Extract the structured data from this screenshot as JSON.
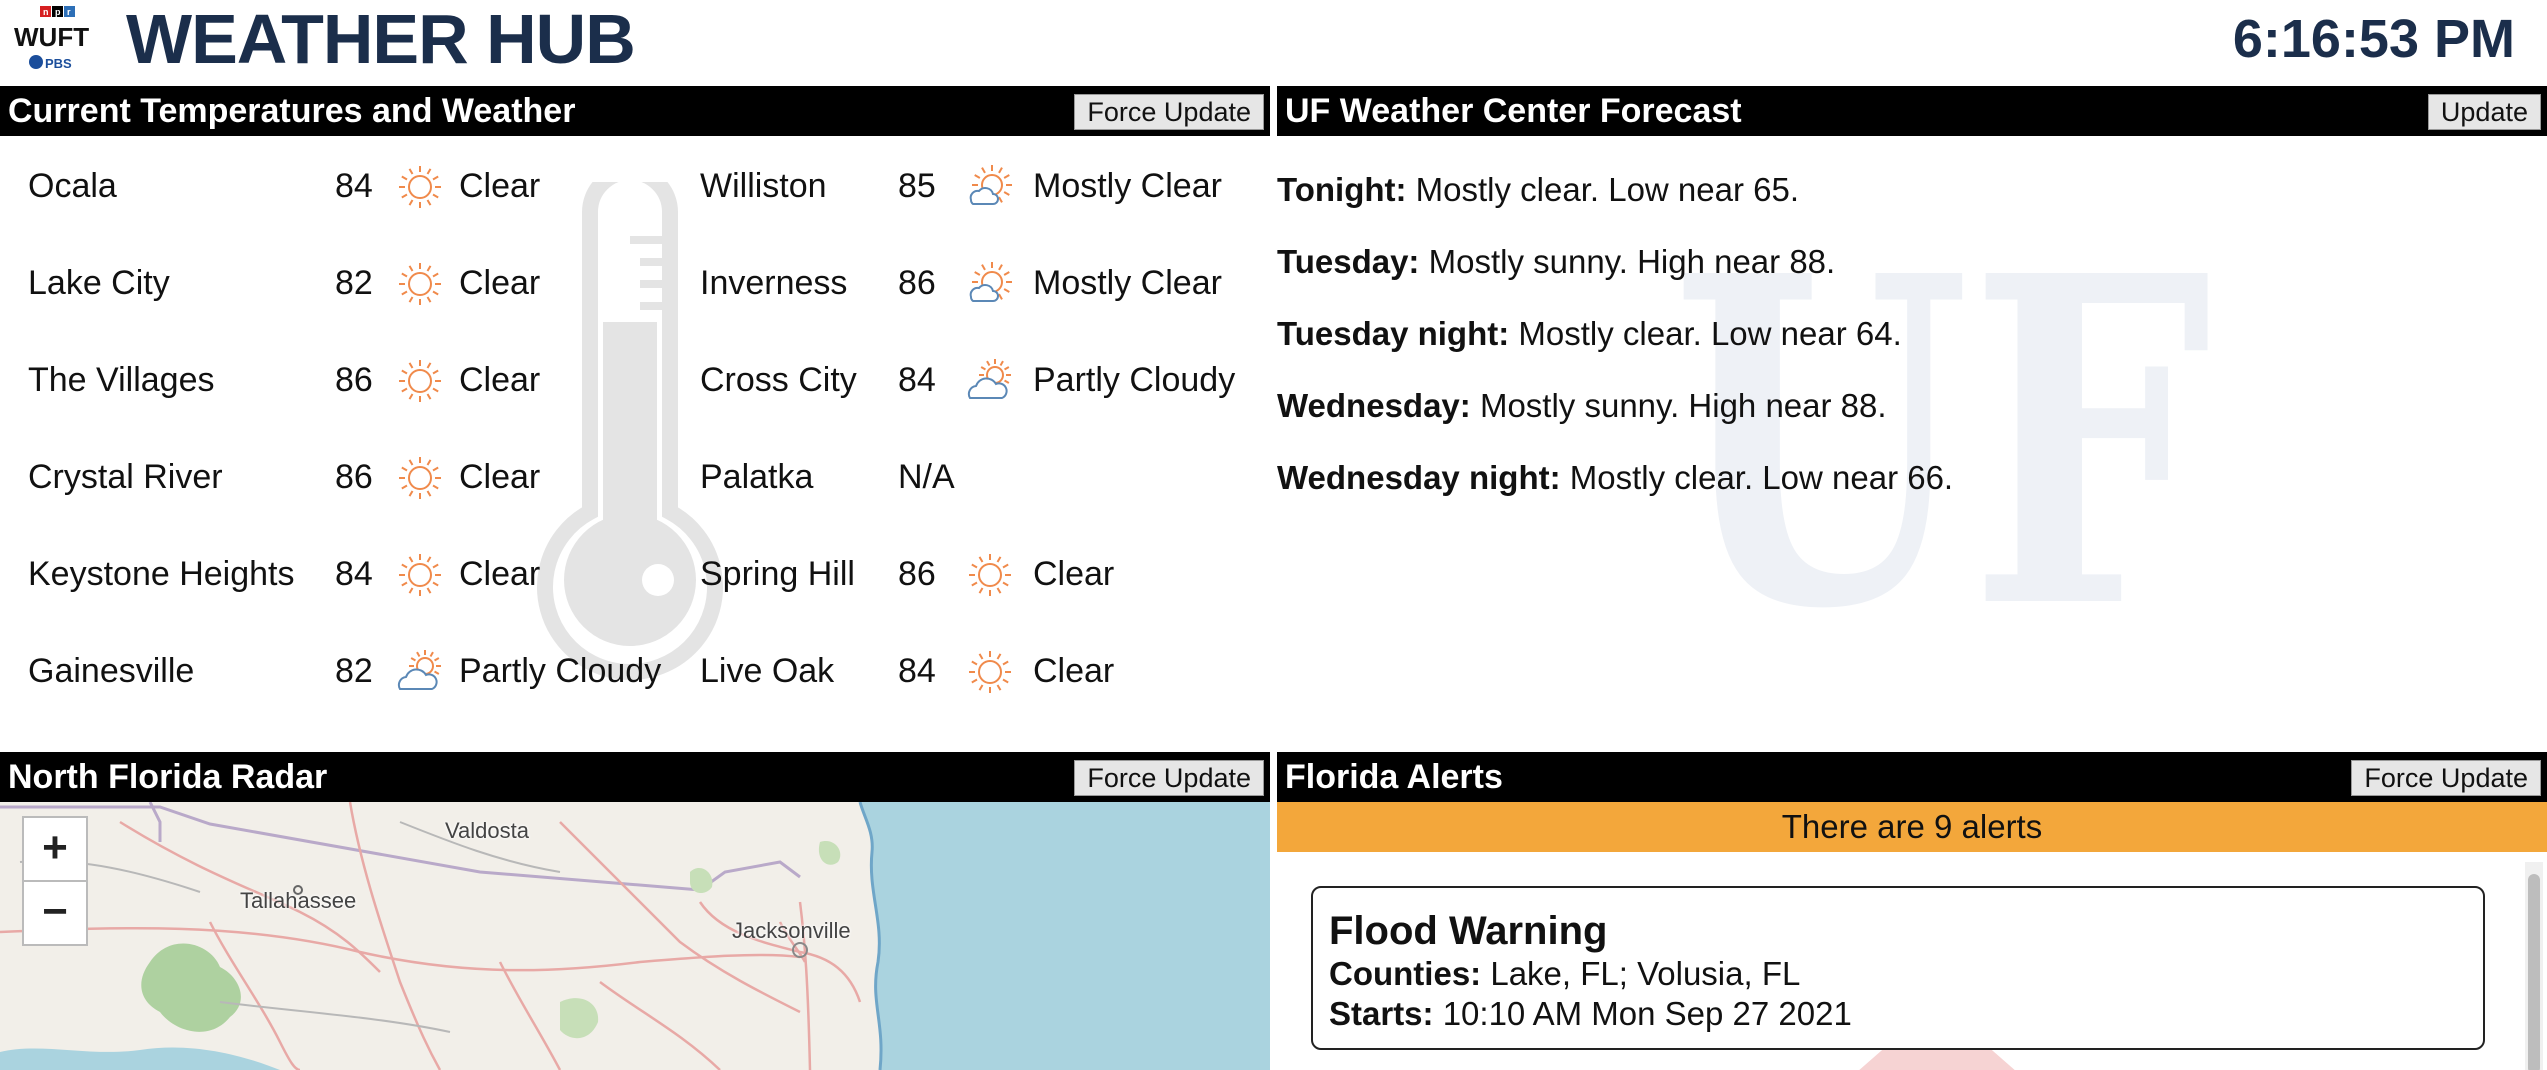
{
  "header": {
    "logo_top": "npr",
    "logo_mid": "WUFT",
    "logo_bottom": "PBS",
    "title": "WEATHER HUB",
    "clock": "6:16:53 PM"
  },
  "temps_panel": {
    "title": "Current Temperatures and Weather",
    "button": "Force Update",
    "left_column": [
      {
        "city": "Ocala",
        "temp": "84",
        "icon": "sun-icon",
        "condition": "Clear"
      },
      {
        "city": "Lake City",
        "temp": "82",
        "icon": "sun-icon",
        "condition": "Clear"
      },
      {
        "city": "The Villages",
        "temp": "86",
        "icon": "sun-icon",
        "condition": "Clear"
      },
      {
        "city": "Crystal River",
        "temp": "86",
        "icon": "sun-icon",
        "condition": "Clear"
      },
      {
        "city": "Keystone Heights",
        "temp": "84",
        "icon": "sun-icon",
        "condition": "Clear"
      },
      {
        "city": "Gainesville",
        "temp": "82",
        "icon": "partly-cloudy-icon",
        "condition": "Partly Cloudy"
      }
    ],
    "right_column": [
      {
        "city": "Williston",
        "temp": "85",
        "icon": "mostly-clear-icon",
        "condition": "Mostly Clear"
      },
      {
        "city": "Inverness",
        "temp": "86",
        "icon": "mostly-clear-icon",
        "condition": "Mostly Clear"
      },
      {
        "city": "Cross City",
        "temp": "84",
        "icon": "partly-cloudy-icon",
        "condition": "Partly Cloudy"
      },
      {
        "city": "Palatka",
        "temp": "N/A",
        "icon": "",
        "condition": ""
      },
      {
        "city": "Spring Hill",
        "temp": "86",
        "icon": "sun-icon",
        "condition": "Clear"
      },
      {
        "city": "Live Oak",
        "temp": "84",
        "icon": "sun-icon",
        "condition": "Clear"
      }
    ]
  },
  "forecast_panel": {
    "title": "UF Weather Center Forecast",
    "button": "Update",
    "watermark": "UF",
    "periods": [
      {
        "label": "Tonight:",
        "text": " Mostly clear. Low near 65."
      },
      {
        "label": "Tuesday:",
        "text": " Mostly sunny. High near 88."
      },
      {
        "label": "Tuesday night:",
        "text": " Mostly clear. Low near 64."
      },
      {
        "label": "Wednesday:",
        "text": " Mostly sunny. High near 88."
      },
      {
        "label": "Wednesday night:",
        "text": " Mostly clear. Low near 66."
      }
    ]
  },
  "radar_panel": {
    "title": "North Florida Radar",
    "button": "Force Update",
    "zoom_in": "+",
    "zoom_out": "−",
    "labels": [
      "Valdosta",
      "Tallahassee",
      "Jacksonville"
    ]
  },
  "alerts_panel": {
    "title": "Florida Alerts",
    "button": "Force Update",
    "banner": "There are 9 alerts",
    "alerts": [
      {
        "title": "Flood Warning",
        "counties_label": "Counties:",
        "counties": " Lake, FL; Volusia, FL",
        "starts_label": "Starts:",
        "starts": " 10:10 AM Mon Sep 27 2021"
      }
    ]
  },
  "colors": {
    "title_navy": "#1b2e4b",
    "bar_black": "#000000",
    "icon_orange": "#f08a4b",
    "alert_orange": "#f3a73b",
    "water_blue": "#aad3df",
    "land": "#f2efe9"
  }
}
